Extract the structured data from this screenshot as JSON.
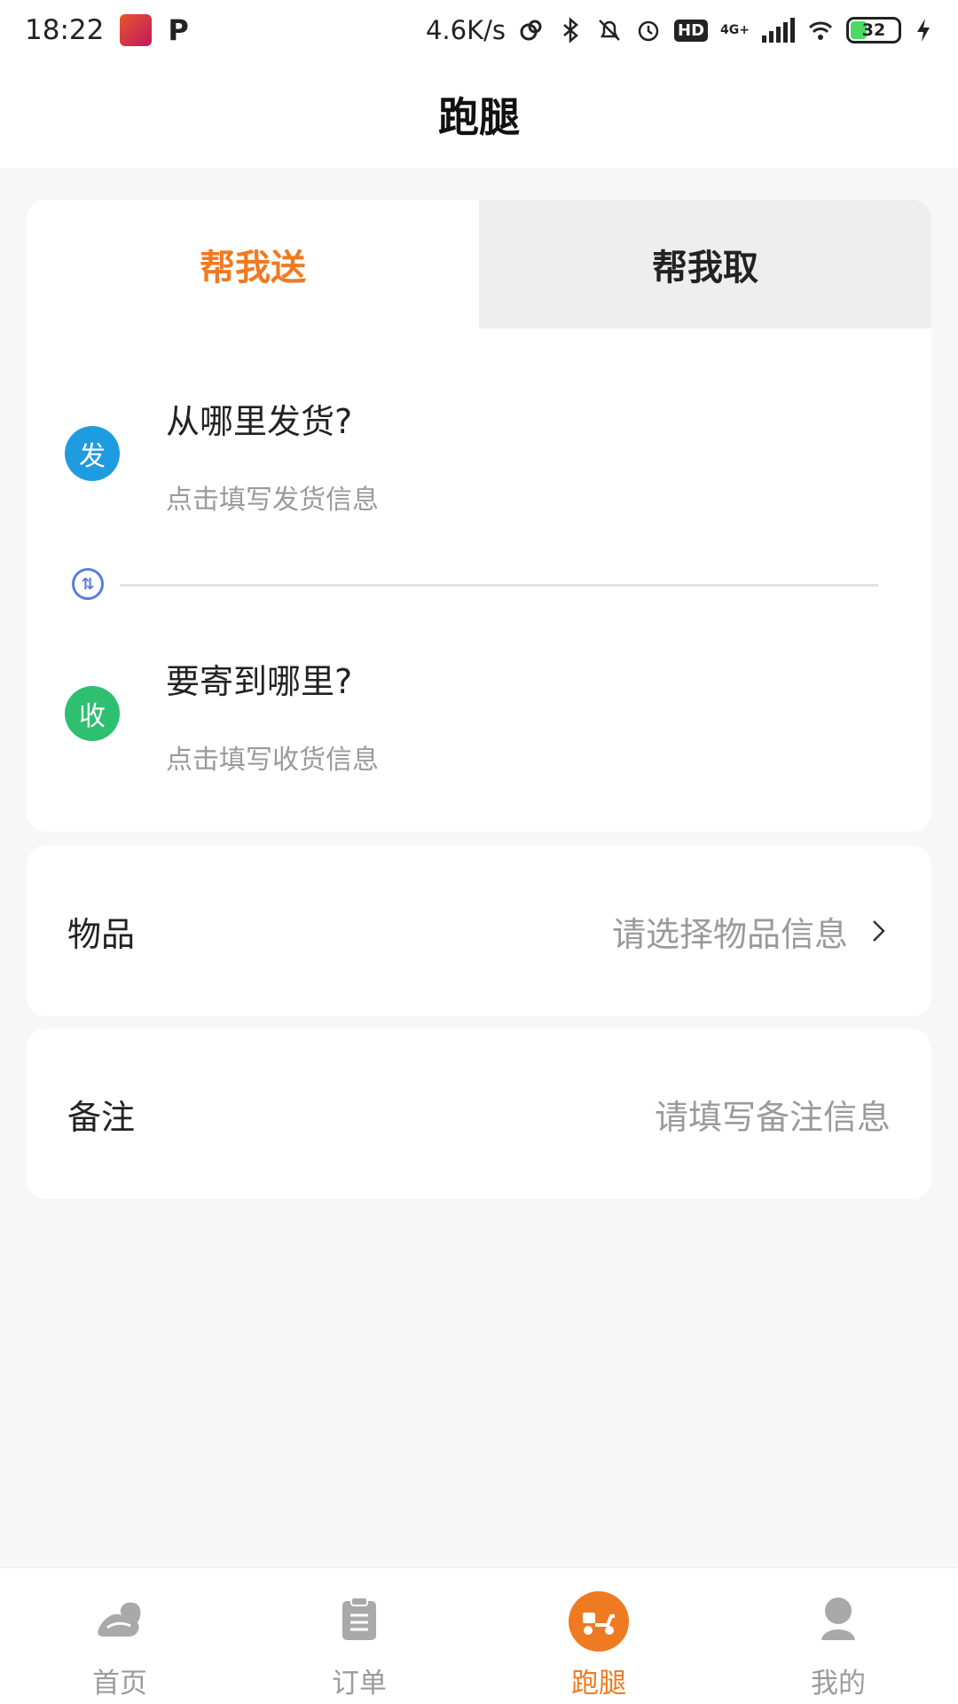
{
  "status_bar": {
    "time": "18:22",
    "speed": "4.6K/s",
    "network": "4G+",
    "hd": "HD",
    "battery": "32"
  },
  "header": {
    "title": "跑腿"
  },
  "tabs": [
    {
      "label": "帮我送",
      "active": true
    },
    {
      "label": "帮我取",
      "active": false
    }
  ],
  "send": {
    "badge": "发",
    "title": "从哪里发货?",
    "hint": "点击填写发货信息"
  },
  "receive": {
    "badge": "收",
    "title": "要寄到哪里?",
    "hint": "点击填写收货信息"
  },
  "goods": {
    "label": "物品",
    "placeholder": "请选择物品信息"
  },
  "note": {
    "label": "备注",
    "placeholder": "请填写备注信息"
  },
  "tabbar": [
    {
      "label": "首页",
      "icon": "home-icon"
    },
    {
      "label": "订单",
      "icon": "order-icon"
    },
    {
      "label": "跑腿",
      "icon": "scooter-icon",
      "active": true
    },
    {
      "label": "我的",
      "icon": "profile-icon"
    }
  ],
  "colors": {
    "accent": "#f07a22",
    "send_badge": "#1f9be0",
    "receive_badge": "#2fbf71",
    "swap": "#5b7fd6"
  }
}
